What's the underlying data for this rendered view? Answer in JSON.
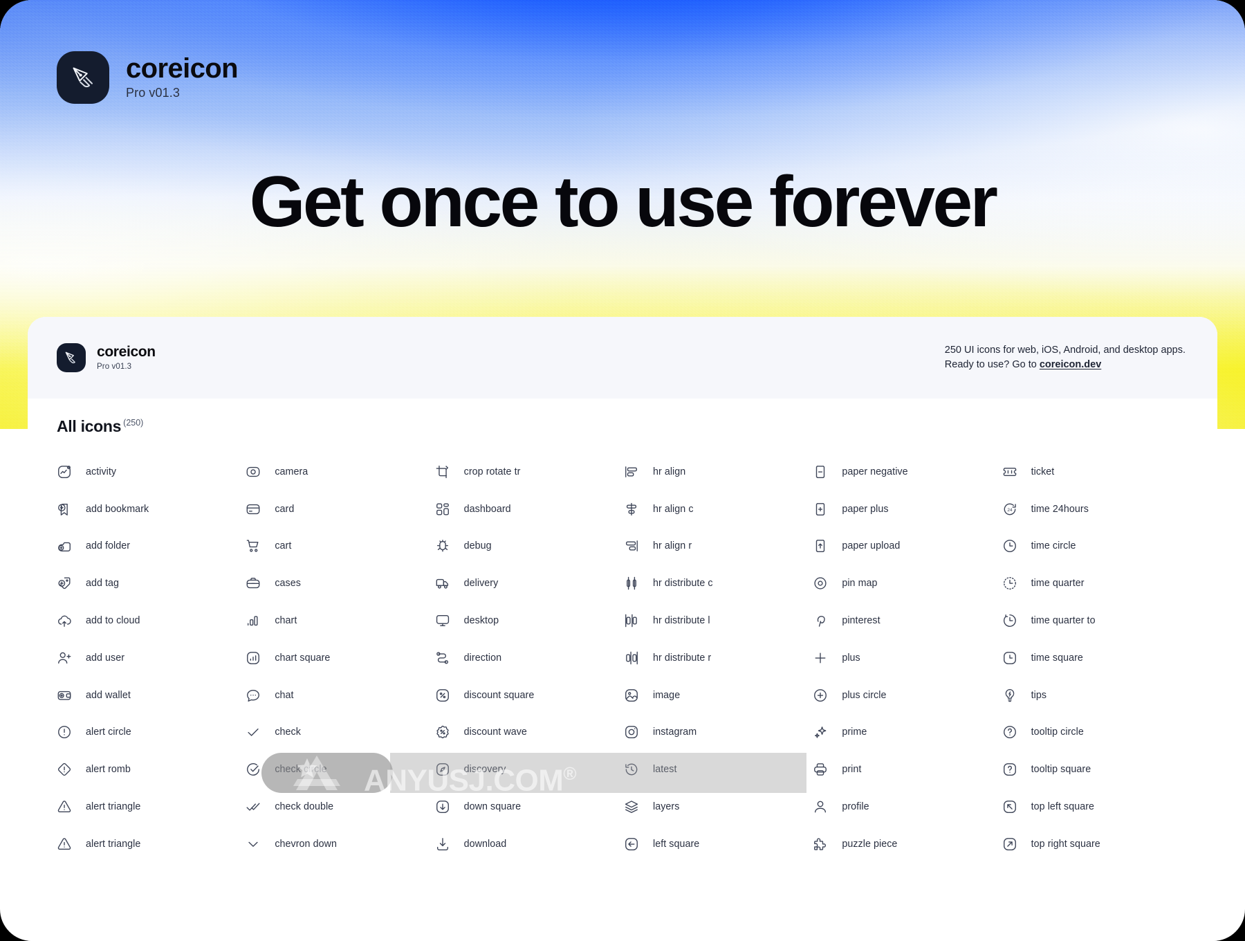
{
  "hero": {
    "brand_name": "coreicon",
    "brand_version": "Pro v01.3",
    "headline": "Get once to use forever",
    "logo_icon": "pen-nib-icon",
    "colors": {
      "blue": "#2a63f6",
      "yellow": "#f5ef1b",
      "mark_bg": "#141c2e"
    }
  },
  "sheet": {
    "brand_name": "coreicon",
    "brand_version": "Pro v01.3",
    "note_line1": "250 UI icons for web, iOS, Android, and desktop apps.",
    "note_line2_prefix": "Ready to use? Go to ",
    "note_link": "coreicon.dev"
  },
  "section": {
    "title": "All icons",
    "count": "(250)"
  },
  "icons": [
    {
      "name": "activity",
      "icon": "activity-icon"
    },
    {
      "name": "camera",
      "icon": "camera-icon"
    },
    {
      "name": "crop rotate tr",
      "icon": "crop-rotate-tr-icon"
    },
    {
      "name": "hr align",
      "icon": "hr-align-icon"
    },
    {
      "name": "paper negative",
      "icon": "paper-negative-icon"
    },
    {
      "name": "ticket",
      "icon": "ticket-icon"
    },
    {
      "name": "add bookmark",
      "icon": "add-bookmark-icon"
    },
    {
      "name": "card",
      "icon": "card-icon"
    },
    {
      "name": "dashboard",
      "icon": "dashboard-icon"
    },
    {
      "name": "hr align c",
      "icon": "hr-align-c-icon"
    },
    {
      "name": "paper plus",
      "icon": "paper-plus-icon"
    },
    {
      "name": "time 24hours",
      "icon": "time-24hours-icon"
    },
    {
      "name": "add folder",
      "icon": "add-folder-icon"
    },
    {
      "name": "cart",
      "icon": "cart-icon"
    },
    {
      "name": "debug",
      "icon": "debug-icon"
    },
    {
      "name": "hr align r",
      "icon": "hr-align-r-icon"
    },
    {
      "name": "paper upload",
      "icon": "paper-upload-icon"
    },
    {
      "name": "time circle",
      "icon": "time-circle-icon"
    },
    {
      "name": "add tag",
      "icon": "add-tag-icon"
    },
    {
      "name": "cases",
      "icon": "cases-icon"
    },
    {
      "name": "delivery",
      "icon": "delivery-icon"
    },
    {
      "name": "hr distribute c",
      "icon": "hr-distribute-c-icon"
    },
    {
      "name": "pin map",
      "icon": "pin-map-icon"
    },
    {
      "name": "time quarter",
      "icon": "time-quarter-icon"
    },
    {
      "name": "add to cloud",
      "icon": "add-to-cloud-icon"
    },
    {
      "name": "chart",
      "icon": "chart-icon"
    },
    {
      "name": "desktop",
      "icon": "desktop-icon"
    },
    {
      "name": "hr distribute l",
      "icon": "hr-distribute-l-icon"
    },
    {
      "name": "pinterest",
      "icon": "pinterest-icon"
    },
    {
      "name": "time quarter to",
      "icon": "time-quarter-to-icon"
    },
    {
      "name": "add user",
      "icon": "add-user-icon"
    },
    {
      "name": "chart square",
      "icon": "chart-square-icon"
    },
    {
      "name": "direction",
      "icon": "direction-icon"
    },
    {
      "name": "hr distribute r",
      "icon": "hr-distribute-r-icon"
    },
    {
      "name": "plus",
      "icon": "plus-icon"
    },
    {
      "name": "time square",
      "icon": "time-square-icon"
    },
    {
      "name": "add wallet",
      "icon": "add-wallet-icon"
    },
    {
      "name": "chat",
      "icon": "chat-icon"
    },
    {
      "name": "discount square",
      "icon": "discount-square-icon"
    },
    {
      "name": "image",
      "icon": "image-icon"
    },
    {
      "name": "plus circle",
      "icon": "plus-circle-icon"
    },
    {
      "name": "tips",
      "icon": "tips-icon"
    },
    {
      "name": "alert circle",
      "icon": "alert-circle-icon"
    },
    {
      "name": "check",
      "icon": "check-icon"
    },
    {
      "name": "discount wave",
      "icon": "discount-wave-icon"
    },
    {
      "name": "instagram",
      "icon": "instagram-icon"
    },
    {
      "name": "prime",
      "icon": "prime-icon"
    },
    {
      "name": "tooltip circle",
      "icon": "tooltip-circle-icon"
    },
    {
      "name": "alert romb",
      "icon": "alert-romb-icon"
    },
    {
      "name": "check circle",
      "icon": "check-circle-icon"
    },
    {
      "name": "discovery",
      "icon": "discovery-icon"
    },
    {
      "name": "latest",
      "icon": "latest-icon"
    },
    {
      "name": "print",
      "icon": "print-icon"
    },
    {
      "name": "tooltip square",
      "icon": "tooltip-square-icon"
    },
    {
      "name": "alert triangle",
      "icon": "alert-triangle-icon"
    },
    {
      "name": "check double",
      "icon": "check-double-icon"
    },
    {
      "name": "down square",
      "icon": "down-square-icon"
    },
    {
      "name": "layers",
      "icon": "layers-icon"
    },
    {
      "name": "profile",
      "icon": "profile-icon"
    },
    {
      "name": "top left square",
      "icon": "top-left-square-icon"
    },
    {
      "name": "alert triangle",
      "icon": "alert-triangle-icon"
    },
    {
      "name": "chevron down",
      "icon": "chevron-down-icon"
    },
    {
      "name": "download",
      "icon": "download-icon"
    },
    {
      "name": "left square",
      "icon": "left-square-icon"
    },
    {
      "name": "puzzle piece",
      "icon": "puzzle-piece-icon"
    },
    {
      "name": "top right square",
      "icon": "top-right-square-icon"
    }
  ],
  "watermark": {
    "text": "ANYUSJ.COM",
    "registered": "®"
  }
}
